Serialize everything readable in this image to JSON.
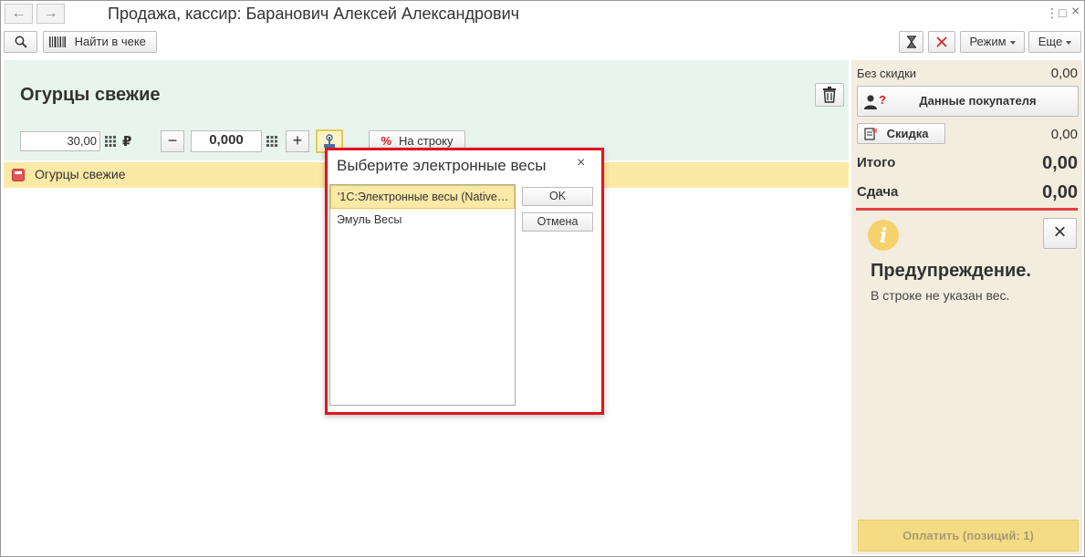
{
  "window": {
    "title": "Продажа, кассир: Баранович Алексей Александрович",
    "back_icon": "←",
    "forward_icon": "→",
    "menu_icon": "⋮",
    "maximize_icon": "□",
    "close_icon": "×"
  },
  "toolbar": {
    "search_icon": "magnifier",
    "find_in_receipt_label": "Найти в чеке",
    "mode_label": "Режим",
    "more_label": "Еще"
  },
  "product": {
    "name": "Огурцы свежие",
    "price": "30,00",
    "currency": "₽",
    "quantity": "0,000",
    "minus_label": "−",
    "plus_label": "+",
    "per_line_label": "На строку",
    "percent_symbol": "%"
  },
  "receipt_rows": [
    {
      "name": "Огурцы свежие"
    }
  ],
  "summary": {
    "no_discount_label": "Без скидки",
    "no_discount_value": "0,00",
    "buyer_data_label": "Данные покупателя",
    "discount_label": "Скидка",
    "discount_value": "0,00",
    "total_label": "Итого",
    "total_value": "0,00",
    "change_label": "Сдача",
    "change_value": "0,00",
    "pay_label": "Оплатить (позиций: 1)"
  },
  "warning": {
    "title": "Предупреждение.",
    "message": "В строке не указан вес.",
    "close_icon": "×",
    "info_icon": "i"
  },
  "modal": {
    "title": "Выберите электронные весы",
    "close_icon": "×",
    "items": [
      "'1С:Электронные весы (Native…",
      "Эмуль Весы"
    ],
    "ok_label": "OK",
    "cancel_label": "Отмена"
  },
  "colors": {
    "panel_green": "#e8f5ee",
    "selection_yellow": "#fbe9a6",
    "right_panel": "#f3ede0",
    "highlight_red": "#e0141e",
    "pay_button": "#f5dc84"
  }
}
